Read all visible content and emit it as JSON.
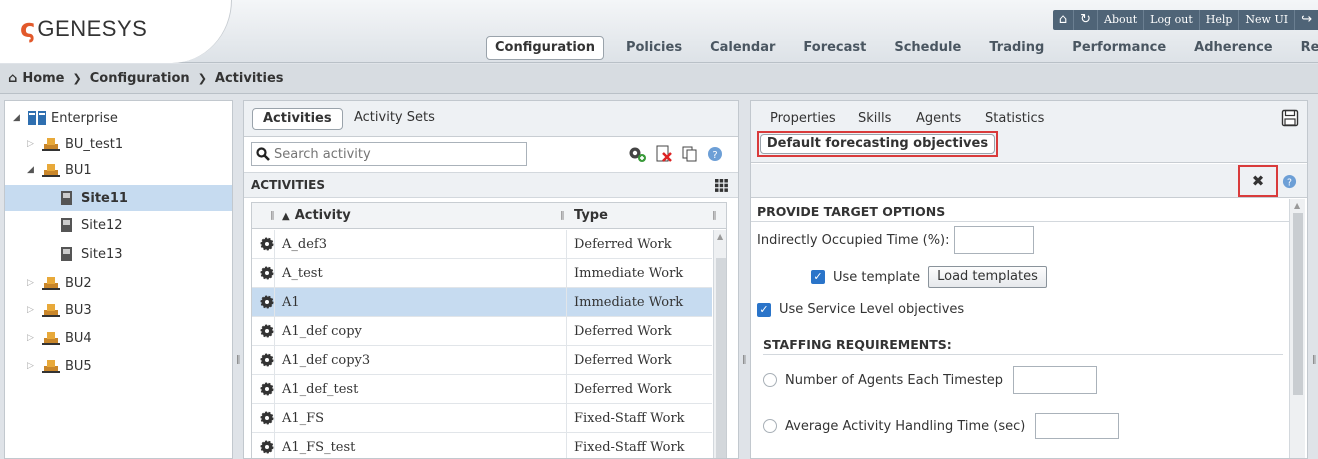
{
  "header": {
    "logo_text": "GENESYS",
    "top_links": [
      "About",
      "Log out",
      "Help",
      "New UI"
    ],
    "nav": [
      "Configuration",
      "Policies",
      "Calendar",
      "Forecast",
      "Schedule",
      "Trading",
      "Performance",
      "Adherence",
      "Reports"
    ],
    "active_nav": "Configuration",
    "colors": {
      "accent_orange": "#e2592b",
      "selection": "#c6dbf0",
      "highlight_red": "#d93b3b"
    }
  },
  "breadcrumb": [
    "Home",
    "Configuration",
    "Activities"
  ],
  "tree": {
    "items": [
      {
        "label": "Enterprise",
        "icon": "enterprise-book-icon",
        "expanded": true
      },
      {
        "label": "BU_test1",
        "icon": "business-unit-icon",
        "expanded": false
      },
      {
        "label": "BU1",
        "icon": "business-unit-icon",
        "expanded": true
      },
      {
        "label": "Site11",
        "icon": "site-icon",
        "selected": true
      },
      {
        "label": "Site12",
        "icon": "site-icon"
      },
      {
        "label": "Site13",
        "icon": "site-icon"
      },
      {
        "label": "BU2",
        "icon": "business-unit-icon",
        "expanded": false
      },
      {
        "label": "BU3",
        "icon": "business-unit-icon",
        "expanded": false
      },
      {
        "label": "BU4",
        "icon": "business-unit-icon",
        "expanded": false
      },
      {
        "label": "BU5",
        "icon": "business-unit-icon",
        "expanded": false
      }
    ]
  },
  "activities_panel": {
    "tabs": [
      "Activities",
      "Activity Sets"
    ],
    "search_placeholder": "Search activity",
    "section_title": "ACTIVITIES",
    "columns": [
      "Activity",
      "Type"
    ],
    "rows": [
      {
        "activity": "A_def3",
        "type": "Deferred Work"
      },
      {
        "activity": "A_test",
        "type": "Immediate Work"
      },
      {
        "activity": "A1",
        "type": "Immediate Work",
        "selected": true
      },
      {
        "activity": "A1_def copy",
        "type": "Deferred Work"
      },
      {
        "activity": "A1_def copy3",
        "type": "Deferred Work"
      },
      {
        "activity": "A1_def_test",
        "type": "Deferred Work"
      },
      {
        "activity": "A1_FS",
        "type": "Fixed-Staff Work"
      },
      {
        "activity": "A1_FS_test",
        "type": "Fixed-Staff Work"
      }
    ]
  },
  "properties_panel": {
    "tabs": [
      "Properties",
      "Skills",
      "Agents",
      "Statistics"
    ],
    "active_tab": "Default forecasting objectives",
    "form": {
      "section_title": "PROVIDE TARGET OPTIONS",
      "indirect_label": "Indirectly Occupied Time (%):",
      "use_template_label": "Use template",
      "load_templates_button": "Load templates",
      "use_sl_label": "Use Service Level objectives",
      "staffing_title": "STAFFING REQUIREMENTS:",
      "num_agents_label": "Number of Agents Each Timestep",
      "aht_label": "Average Activity Handling Time (sec)"
    }
  }
}
